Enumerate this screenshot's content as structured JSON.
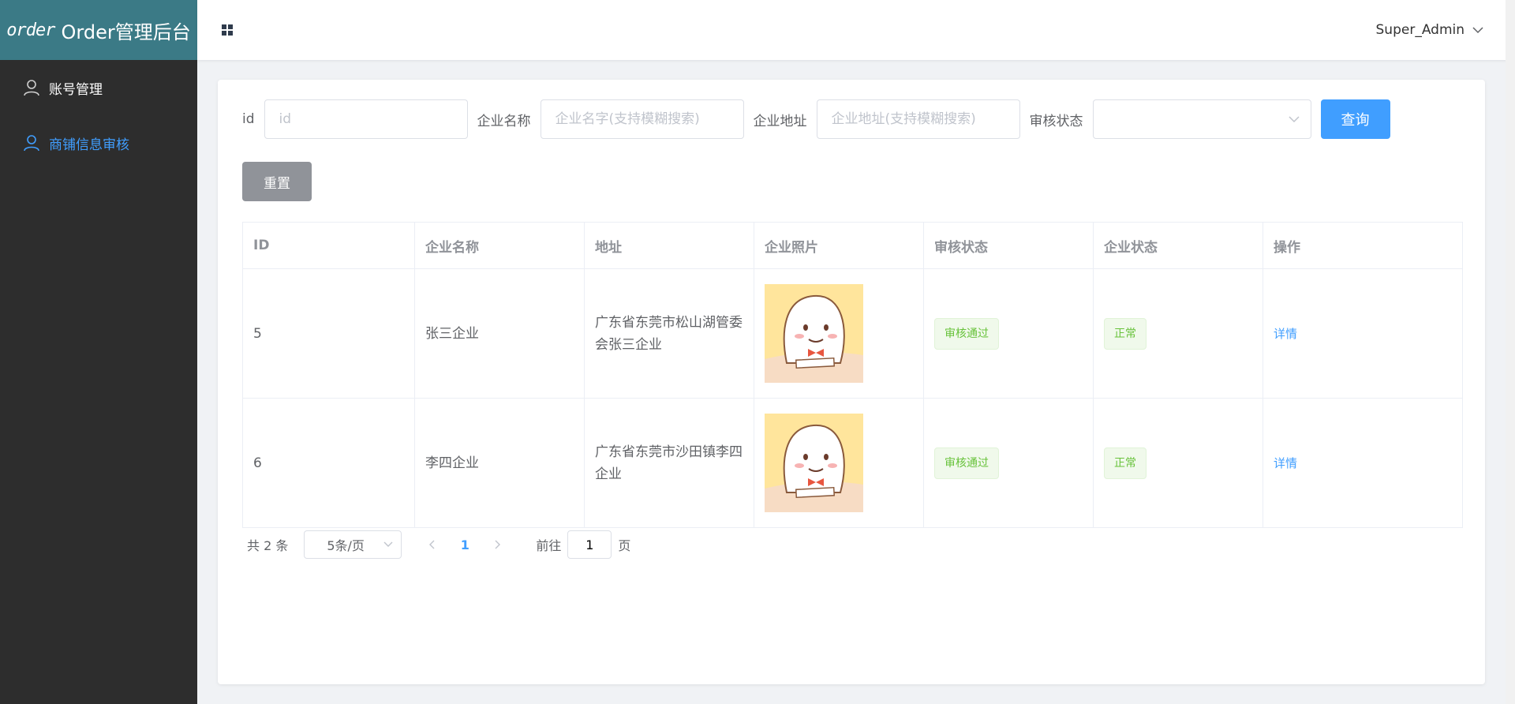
{
  "brand": {
    "logo_word": "order",
    "title": "Order管理后台"
  },
  "sidebar": {
    "items": [
      {
        "label": "账号管理",
        "icon": "user-icon",
        "active": false
      },
      {
        "label": "商铺信息审核",
        "icon": "user-icon",
        "active": true
      }
    ]
  },
  "header": {
    "menu_icon": "grid-icon",
    "username": "Super_Admin"
  },
  "filters": {
    "id_label": "id",
    "id_placeholder": "id",
    "name_label": "企业名称",
    "name_placeholder": "企业名字(支持模糊搜索)",
    "address_label": "企业地址",
    "address_placeholder": "企业地址(支持模糊搜索)",
    "status_label": "审核状态",
    "status_value": "",
    "query_button": "查询",
    "reset_button": "重置"
  },
  "table": {
    "columns": [
      "ID",
      "企业名称",
      "地址",
      "企业照片",
      "审核状态",
      "企业状态",
      "操作"
    ],
    "rows": [
      {
        "id": "5",
        "name": "张三企业",
        "address": "广东省东莞市松山湖管委会张三企业",
        "audit_status": "审核通过",
        "company_status": "正常",
        "action": "详情"
      },
      {
        "id": "6",
        "name": "李四企业",
        "address": "广东省东莞市沙田镇李四企业",
        "audit_status": "审核通过",
        "company_status": "正常",
        "action": "详情"
      }
    ]
  },
  "pagination": {
    "total_text": "共 2 条",
    "page_size": "5条/页",
    "current_page": "1",
    "goto_prefix": "前往",
    "goto_value": "1",
    "goto_suffix": "页"
  },
  "colors": {
    "primary": "#409eff",
    "sidebar_bg": "#2d2d2d",
    "brand_bg": "#3b7a86",
    "success": "#67c23a"
  }
}
